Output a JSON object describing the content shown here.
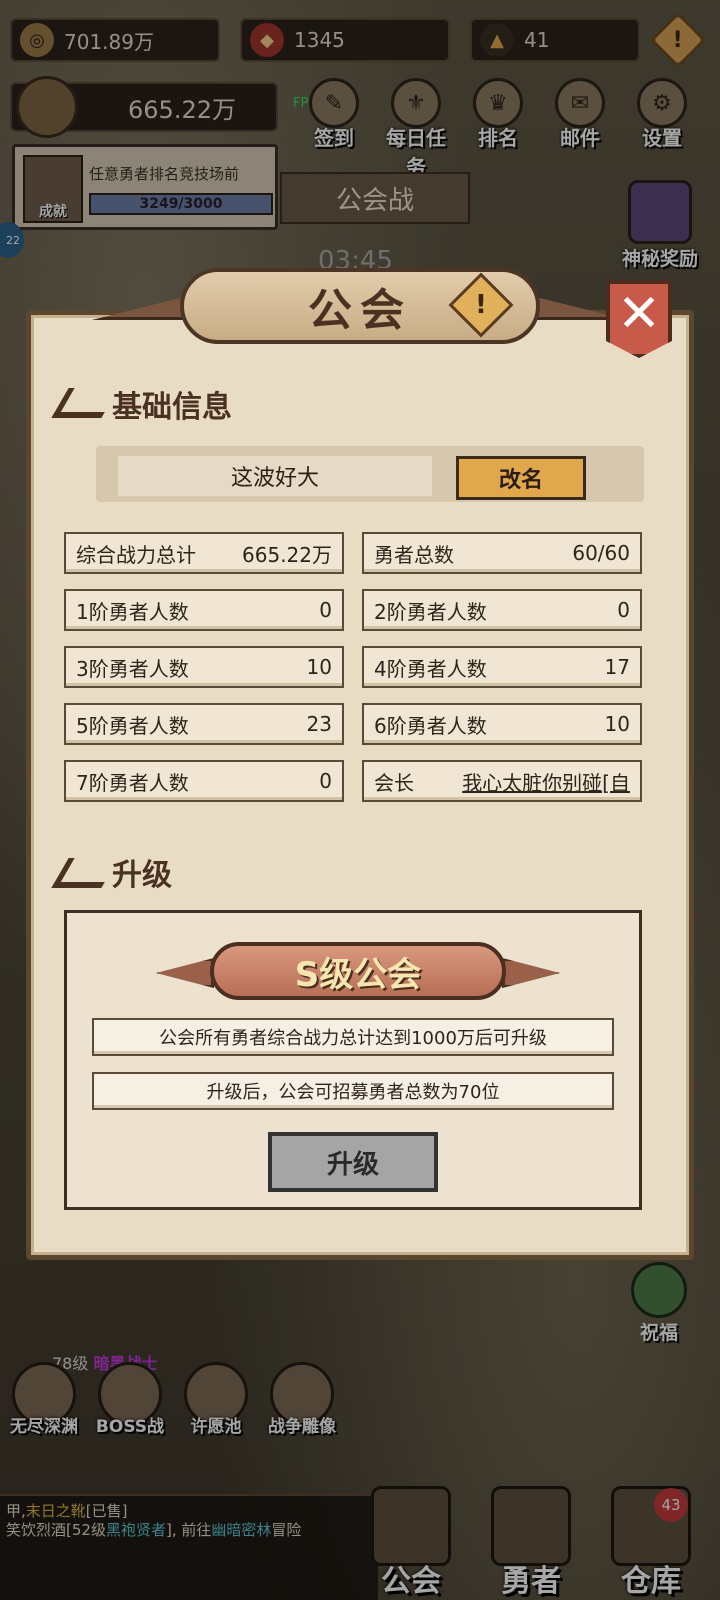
{
  "topbar": {
    "gold": "701.89万",
    "gems": "1345",
    "energy": "41"
  },
  "power": "665.22万",
  "fps": "FPS65",
  "top_icons": [
    {
      "label": "签到",
      "icon": "checkin-icon"
    },
    {
      "label": "每日任务",
      "icon": "daily-task-icon"
    },
    {
      "label": "排名",
      "icon": "ranking-icon"
    },
    {
      "label": "邮件",
      "icon": "mail-icon"
    },
    {
      "label": "设置",
      "icon": "gear-icon"
    }
  ],
  "quest": {
    "text": "任意勇者排名竞技场前",
    "avatar_label": "成就",
    "progress": "3249/3000"
  },
  "guild_war_tab": "公会战",
  "timer_ghost": "03:45",
  "mystery_reward": "神秘奖励",
  "side_badge": "22",
  "modal": {
    "title": "公会",
    "section_basic": "基础信息",
    "guild_name": "这波好大",
    "rename_btn": "改名",
    "stats": [
      {
        "label": "综合战力总计",
        "value": "665.22万"
      },
      {
        "label": "勇者总数",
        "value": "60/60"
      },
      {
        "label": "1阶勇者人数",
        "value": "0"
      },
      {
        "label": "2阶勇者人数",
        "value": "0"
      },
      {
        "label": "3阶勇者人数",
        "value": "10"
      },
      {
        "label": "4阶勇者人数",
        "value": "17"
      },
      {
        "label": "5阶勇者人数",
        "value": "23"
      },
      {
        "label": "6阶勇者人数",
        "value": "10"
      },
      {
        "label": "7阶勇者人数",
        "value": "0"
      },
      {
        "label": "会长",
        "value": "我心太脏你别碰[自"
      }
    ],
    "section_upgrade": "升级",
    "grade": "S级公会",
    "upgrade_info_1": "公会所有勇者综合战力总计达到1000万后可升级",
    "upgrade_info_2": "升级后，公会可招募勇者总数为70位",
    "upgrade_btn": "升级"
  },
  "bless": "祝福",
  "level_text": {
    "lv": "78级",
    "name": "暗黑战士"
  },
  "modes": [
    {
      "label": "无尽深渊",
      "icon": "abyss-icon"
    },
    {
      "label": "BOSS战",
      "icon": "boss-icon"
    },
    {
      "label": "许愿池",
      "icon": "wish-pool-icon"
    },
    {
      "label": "战争雕像",
      "icon": "statue-icon"
    }
  ],
  "chat": {
    "line1_prefix": "甲,",
    "line1_item": "末日之靴",
    "line1_suffix": "[已售]",
    "line2_a": "笑饮烈酒[52级",
    "line2_b": "黑袍贤者",
    "line2_c": "], 前往",
    "line2_d": "幽暗密林",
    "line2_e": "冒险"
  },
  "bottom_nav": [
    {
      "label": "公会"
    },
    {
      "label": "勇者"
    },
    {
      "label": "仓库",
      "badge": "43"
    }
  ],
  "colors": {
    "accent": "#e1a74c",
    "panel": "#e9dcc5",
    "border": "#5d4630"
  }
}
